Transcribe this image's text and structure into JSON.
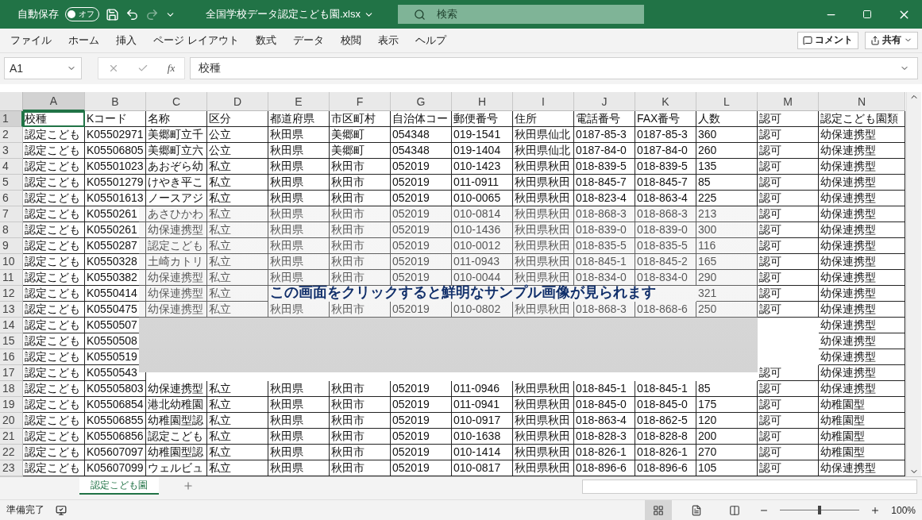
{
  "title_bar": {
    "autosave_label": "自動保存",
    "autosave_toggle": {
      "label": "オフ",
      "on": false
    },
    "file_name": "全国学校データ認定こども園.xlsx",
    "search_placeholder": "検索"
  },
  "menu": [
    {
      "label": "ファイル"
    },
    {
      "label": "ホーム"
    },
    {
      "label": "挿入"
    },
    {
      "label": "ページ レイアウト"
    },
    {
      "label": "数式"
    },
    {
      "label": "データ"
    },
    {
      "label": "校閲"
    },
    {
      "label": "表示"
    },
    {
      "label": "ヘルプ"
    }
  ],
  "menu_buttons": {
    "comment": "コメント",
    "share": "共有"
  },
  "formula_bar": {
    "name_box": "A1",
    "fx": "fx",
    "value": "校種"
  },
  "columns": [
    {
      "label": "A",
      "selected": true
    },
    {
      "label": "B",
      "selected": false
    },
    {
      "label": "C",
      "selected": false
    },
    {
      "label": "D",
      "selected": false
    },
    {
      "label": "E",
      "selected": false
    },
    {
      "label": "F",
      "selected": false
    },
    {
      "label": "G",
      "selected": false
    },
    {
      "label": "H",
      "selected": false
    },
    {
      "label": "I",
      "selected": false
    },
    {
      "label": "J",
      "selected": false
    },
    {
      "label": "K",
      "selected": false
    },
    {
      "label": "L",
      "selected": false
    },
    {
      "label": "M",
      "selected": false
    },
    {
      "label": "N",
      "selected": false
    }
  ],
  "rows": [
    {
      "number": "1",
      "selected": true,
      "cells": [
        "校種",
        "Kコード",
        "名称",
        "区分",
        "都道府県",
        "市区町村",
        "自治体コー",
        "郵便番号",
        "住所",
        "電話番号",
        "FAX番号",
        "人数",
        "認可",
        "認定こども園類"
      ]
    },
    {
      "number": "2",
      "selected": false,
      "cells": [
        "認定こども",
        "K05502971",
        "美郷町立千",
        "公立",
        "秋田県",
        "美郷町",
        "054348",
        "019-1541",
        "秋田県仙北",
        "0187-85-3",
        "0187-85-3",
        "360",
        "認可",
        "幼保連携型"
      ]
    },
    {
      "number": "3",
      "selected": false,
      "cells": [
        "認定こども",
        "K05506805",
        "美郷町立六",
        "公立",
        "秋田県",
        "美郷町",
        "054348",
        "019-1404",
        "秋田県仙北",
        "0187-84-0",
        "0187-84-0",
        "260",
        "認可",
        "幼保連携型"
      ]
    },
    {
      "number": "4",
      "selected": false,
      "cells": [
        "認定こども",
        "K05501023",
        "あおぞら幼",
        "私立",
        "秋田県",
        "秋田市",
        "052019",
        "010-1423",
        "秋田県秋田",
        "018-839-5",
        "018-839-5",
        "135",
        "認可",
        "幼保連携型"
      ]
    },
    {
      "number": "5",
      "selected": false,
      "cells": [
        "認定こども",
        "K05501279",
        "けやき平こ",
        "私立",
        "秋田県",
        "秋田市",
        "052019",
        "011-0911",
        "秋田県秋田",
        "018-845-7",
        "018-845-7",
        "85",
        "認可",
        "幼保連携型"
      ]
    },
    {
      "number": "6",
      "selected": false,
      "cells": [
        "認定こども",
        "K05501613",
        "ノースアジ",
        "私立",
        "秋田県",
        "秋田市",
        "052019",
        "010-0065",
        "秋田県秋田",
        "018-823-4",
        "018-863-4",
        "225",
        "認可",
        "幼保連携型"
      ]
    },
    {
      "number": "7",
      "selected": false,
      "cells": [
        "認定こども",
        "K0550261",
        "あさひかわ",
        "私立",
        "秋田県",
        "秋田市",
        "052019",
        "010-0814",
        "秋田県秋田",
        "018-868-3",
        "018-868-3",
        "213",
        "認可",
        "幼保連携型"
      ]
    },
    {
      "number": "8",
      "selected": false,
      "cells": [
        "認定こども",
        "K0550261",
        "幼保連携型",
        "私立",
        "秋田県",
        "秋田市",
        "052019",
        "010-1436",
        "秋田県秋田",
        "018-839-0",
        "018-839-0",
        "300",
        "認可",
        "幼保連携型"
      ]
    },
    {
      "number": "9",
      "selected": false,
      "cells": [
        "認定こども",
        "K0550287",
        "認定こども",
        "私立",
        "秋田県",
        "秋田市",
        "052019",
        "010-0012",
        "秋田県秋田",
        "018-835-5",
        "018-835-5",
        "116",
        "認可",
        "幼保連携型"
      ]
    },
    {
      "number": "10",
      "selected": false,
      "cells": [
        "認定こども",
        "K0550328",
        "土崎カトリ",
        "私立",
        "秋田県",
        "秋田市",
        "052019",
        "011-0943",
        "秋田県秋田",
        "018-845-1",
        "018-845-2",
        "165",
        "認可",
        "幼保連携型"
      ]
    },
    {
      "number": "11",
      "selected": false,
      "cells": [
        "認定こども",
        "K0550382",
        "幼保連携型",
        "私立",
        "秋田県",
        "秋田市",
        "052019",
        "010-0044",
        "秋田県秋田",
        "018-834-0",
        "018-834-0",
        "290",
        "認可",
        "幼保連携型"
      ]
    },
    {
      "number": "12",
      "selected": false,
      "cells": [
        "認定こども",
        "K0550414",
        "幼保連携型",
        "私立",
        null,
        null,
        null,
        null,
        null,
        null,
        null,
        "321",
        "認可",
        "幼保連携型"
      ]
    },
    {
      "number": "13",
      "selected": false,
      "cells": [
        "認定こども",
        "K0550475",
        "幼保連携型",
        "私立",
        "秋田県",
        "秋田市",
        "052019",
        "010-0802",
        "秋田県秋田",
        "018-868-3",
        "018-868-6",
        "250",
        "認可",
        "幼保連携型"
      ]
    },
    {
      "number": "14",
      "selected": false,
      "cells": [
        "認定こども",
        "K0550507",
        null,
        null,
        null,
        null,
        null,
        null,
        null,
        null,
        null,
        null,
        null,
        "幼保連携型"
      ]
    },
    {
      "number": "15",
      "selected": false,
      "cells": [
        "認定こども",
        "K0550508",
        null,
        null,
        null,
        null,
        null,
        null,
        null,
        null,
        null,
        null,
        null,
        "幼保連携型"
      ]
    },
    {
      "number": "16",
      "selected": false,
      "cells": [
        "認定こども",
        "K0550519",
        null,
        null,
        null,
        null,
        null,
        null,
        null,
        null,
        null,
        null,
        null,
        "幼保連携型"
      ]
    },
    {
      "number": "17",
      "selected": false,
      "cells": [
        "認定こども",
        "K0550543",
        null,
        null,
        null,
        null,
        null,
        null,
        null,
        null,
        null,
        null,
        "認可",
        "幼保連携型"
      ]
    },
    {
      "number": "18",
      "selected": false,
      "cells": [
        "認定こども",
        "K05505803",
        "幼保連携型",
        "私立",
        "秋田県",
        "秋田市",
        "052019",
        "011-0946",
        "秋田県秋田",
        "018-845-1",
        "018-845-1",
        "85",
        "認可",
        "幼保連携型"
      ]
    },
    {
      "number": "19",
      "selected": false,
      "cells": [
        "認定こども",
        "K05506854",
        "港北幼稚園",
        "私立",
        "秋田県",
        "秋田市",
        "052019",
        "011-0941",
        "秋田県秋田",
        "018-845-0",
        "018-845-0",
        "175",
        "認可",
        "幼稚園型"
      ]
    },
    {
      "number": "20",
      "selected": false,
      "cells": [
        "認定こども",
        "K05506855",
        "幼稚園型認",
        "私立",
        "秋田県",
        "秋田市",
        "052019",
        "010-0917",
        "秋田県秋田",
        "018-863-4",
        "018-862-5",
        "120",
        "認可",
        "幼稚園型"
      ]
    },
    {
      "number": "21",
      "selected": false,
      "cells": [
        "認定こども",
        "K05506856",
        "認定こども",
        "私立",
        "秋田県",
        "秋田市",
        "052019",
        "010-1638",
        "秋田県秋田",
        "018-828-3",
        "018-828-8",
        "200",
        "認可",
        "幼稚園型"
      ]
    },
    {
      "number": "22",
      "selected": false,
      "cells": [
        "認定こども",
        "K05607097",
        "幼稚園型認",
        "私立",
        "秋田県",
        "秋田市",
        "052019",
        "010-1414",
        "秋田県秋田",
        "018-826-1",
        "018-826-1",
        "270",
        "認可",
        "幼稚園型"
      ]
    },
    {
      "number": "23",
      "selected": false,
      "cells": [
        "認定こども",
        "K05607099",
        "ウェルビュ",
        "私立",
        "秋田県",
        "秋田市",
        "052019",
        "010-0817",
        "秋田県秋田",
        "018-896-6",
        "018-896-6",
        "105",
        "認可",
        "幼保連携型"
      ]
    }
  ],
  "overlay": {
    "message": "この画面をクリックすると鮮明なサンプル画像が見られます"
  },
  "sheet_tabs": [
    {
      "label": "認定こども園",
      "selected": true
    }
  ],
  "status_bar": {
    "status": "準備完了",
    "views": [
      {
        "kind": "normal",
        "selected": true
      },
      {
        "kind": "page_layout",
        "selected": false
      },
      {
        "kind": "page_break",
        "selected": false
      }
    ],
    "zoom": {
      "level": 0.5,
      "reading": "100%"
    }
  }
}
